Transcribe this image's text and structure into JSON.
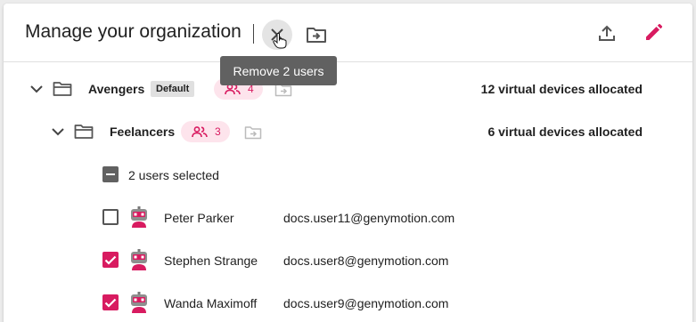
{
  "header": {
    "title": "Manage your organization",
    "tooltip": "Remove 2 users"
  },
  "groups": [
    {
      "name": "Avengers",
      "badge": "Default",
      "user_count": "4",
      "allocation": "12 virtual devices allocated"
    },
    {
      "name": "Feelancers",
      "user_count": "3",
      "allocation": "6 virtual devices allocated"
    }
  ],
  "selection": {
    "label": "2 users selected"
  },
  "users": [
    {
      "name": "Peter Parker",
      "email": "docs.user11@genymotion.com",
      "checked": false
    },
    {
      "name": "Stephen Strange",
      "email": "docs.user8@genymotion.com",
      "checked": true
    },
    {
      "name": "Wanda Maximoff",
      "email": "docs.user9@genymotion.com",
      "checked": true
    }
  ],
  "icons": {
    "close": "close-icon",
    "move": "move-to-folder-icon",
    "upload": "upload-icon",
    "edit": "edit-pencil-icon",
    "folder": "folder-icon",
    "chevron": "chevron-down-icon",
    "users": "users-icon",
    "avatar": "robot-avatar-icon"
  },
  "colors": {
    "accent": "#d81b60",
    "chip_bg": "#fde4ec",
    "tooltip_bg": "#616161",
    "indeterminate": "#616161"
  }
}
